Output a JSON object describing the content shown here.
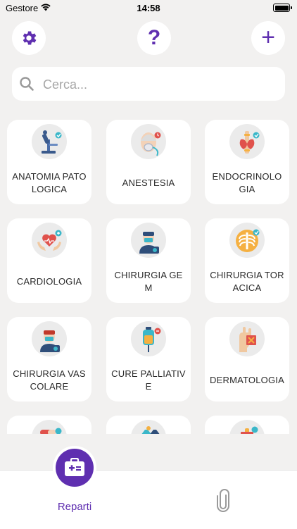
{
  "status_bar": {
    "carrier": "Gestore",
    "time": "14:58"
  },
  "header": {
    "settings_icon": "gear-icon",
    "help_icon": "question-mark-icon",
    "help_glyph": "?",
    "add_icon": "plus-icon",
    "add_glyph": "+"
  },
  "search": {
    "placeholder": "Cerca..."
  },
  "departments": [
    {
      "label": "ANATOMIA PATOLOGICA",
      "icon": "microscope-icon"
    },
    {
      "label": "ANESTESIA",
      "icon": "anesthesia-mask-icon"
    },
    {
      "label": "ENDOCRINOLOGIA",
      "icon": "thyroid-icon"
    },
    {
      "label": "CARDIOLOGIA",
      "icon": "heart-hands-icon"
    },
    {
      "label": "CHIRURGIA GEM",
      "icon": "surgeon-icon"
    },
    {
      "label": "CHIRURGIA TORACICA",
      "icon": "ribcage-icon"
    },
    {
      "label": "CHIRURGIA VASCOLARE",
      "icon": "surgeon-icon"
    },
    {
      "label": "CURE PALLIATIVE",
      "icon": "iv-bag-icon"
    },
    {
      "label": "DERMATOLOGIA",
      "icon": "skin-icon"
    },
    {
      "label": "",
      "icon": "pill-icon"
    },
    {
      "label": "",
      "icon": "lab-flask-icon"
    },
    {
      "label": "",
      "icon": "medical-icon"
    }
  ],
  "tabbar": {
    "active_tab": "Reparti",
    "active_icon": "first-aid-kit-icon",
    "other_icon": "paperclip-icon"
  },
  "colors": {
    "accent": "#5f2fb0",
    "background": "#f2f1f0",
    "card": "#ffffff",
    "badge_teal": "#3ab7c9",
    "badge_red": "#e0524c"
  }
}
